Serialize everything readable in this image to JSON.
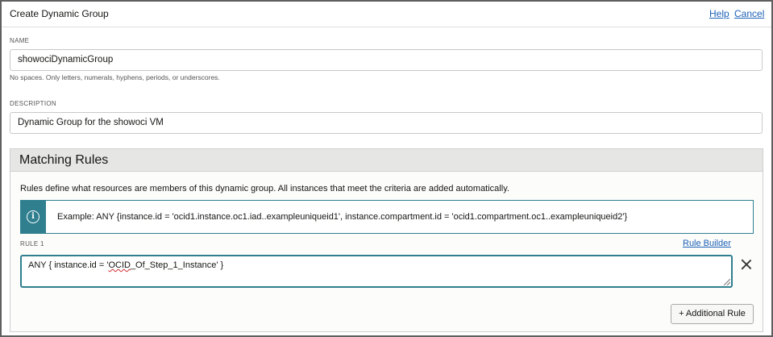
{
  "header": {
    "title": "Create Dynamic Group",
    "help_label": "Help",
    "cancel_label": "Cancel"
  },
  "name_field": {
    "label": "NAME",
    "value": "showociDynamicGroup",
    "hint": "No spaces. Only letters, numerals, hyphens, periods, or underscores."
  },
  "description_field": {
    "label": "DESCRIPTION",
    "value": "Dynamic Group for the showoci VM"
  },
  "matching_rules": {
    "title": "Matching Rules",
    "description": "Rules define what resources are members of this dynamic group. All instances that meet the criteria are added automatically.",
    "info_icon": "info-icon",
    "example": "Example: ANY {instance.id = 'ocid1.instance.oc1.iad..exampleuniqueid1', instance.compartment.id = 'ocid1.compartment.oc1..exampleuniqueid2'}",
    "rule_label": "RULE 1",
    "rule_builder_label": "Rule Builder",
    "rule_value_prefix": "ANY { instance.id = '",
    "rule_value_misspelled": "OCID",
    "rule_value_suffix": "_Of_Step_1_Instance' }",
    "remove_icon": "close-icon",
    "add_rule_label": "+ Additional Rule"
  },
  "colors": {
    "link": "#1c60b5",
    "accent": "#2f7f8f",
    "section_header": "#e6e6e4"
  }
}
